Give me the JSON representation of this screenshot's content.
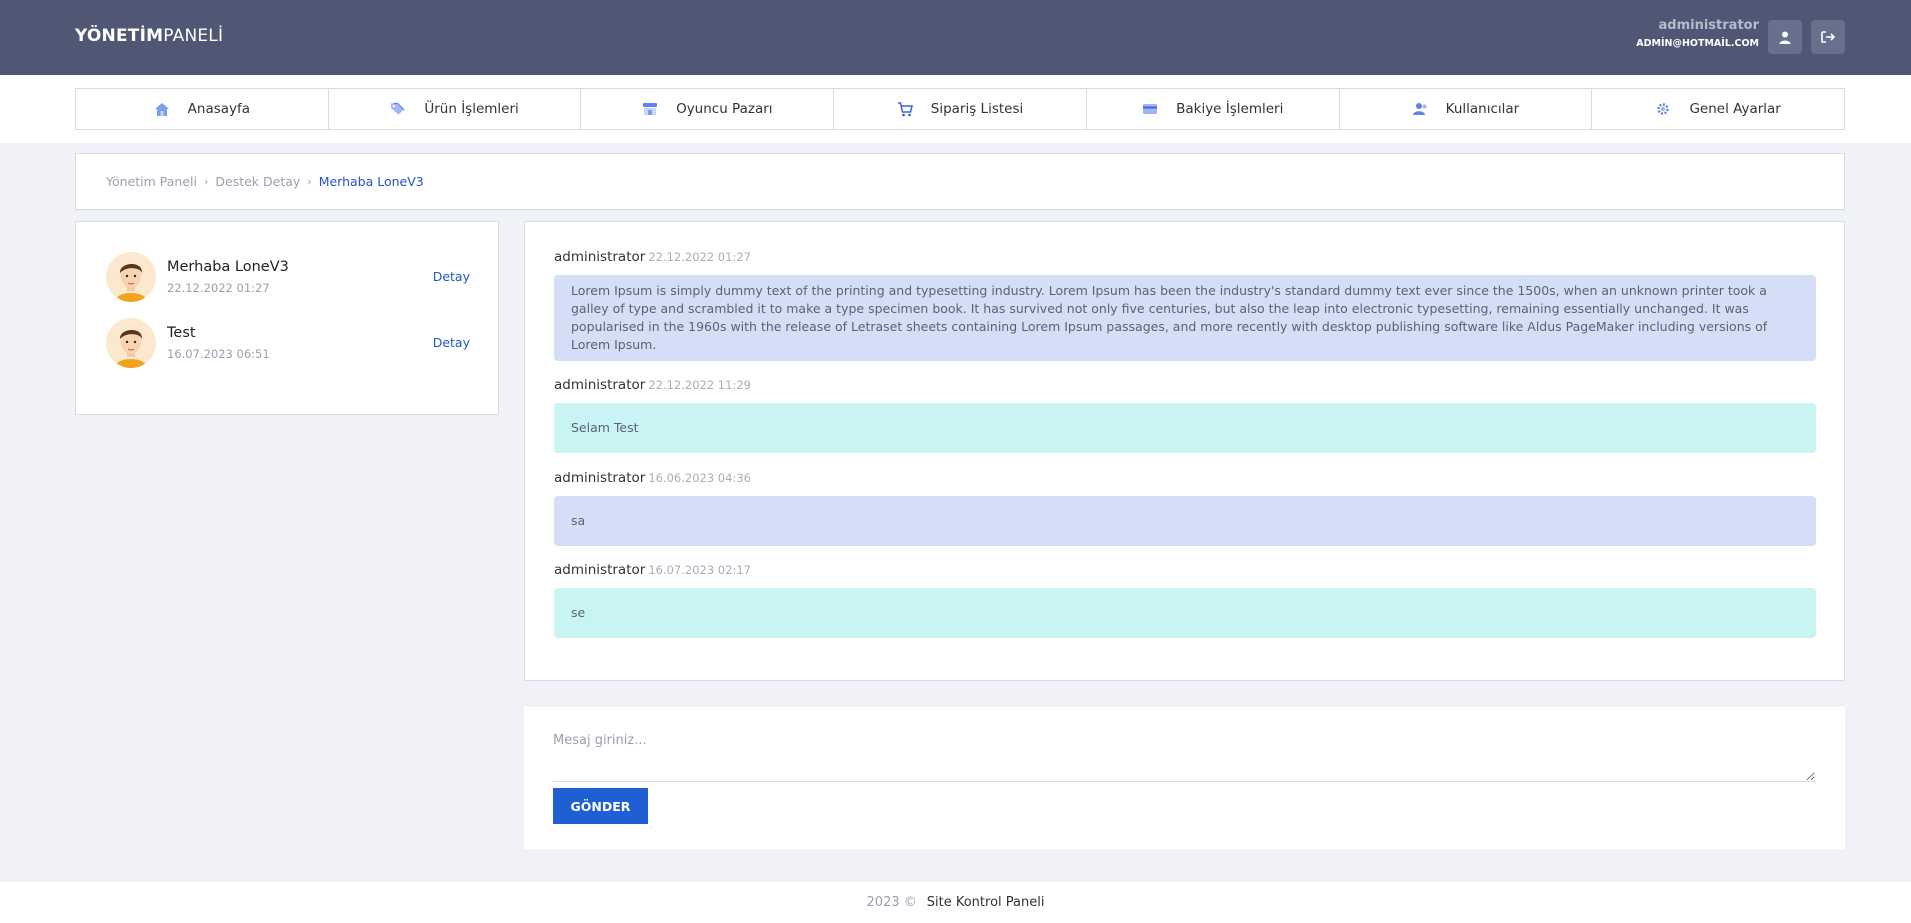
{
  "header": {
    "brand_bold": "YÖNETİM",
    "brand_light": "PANELİ",
    "user_name": "administrator",
    "user_email": "ADMİN@HOTMAİL.COM",
    "profile_icon": "user-icon",
    "logout_icon": "sign-out-icon"
  },
  "nav": {
    "items": [
      {
        "label": "Anasayfa",
        "icon": "home-icon"
      },
      {
        "label": "Ürün İşlemleri",
        "icon": "tags-icon"
      },
      {
        "label": "Oyuncu Pazarı",
        "icon": "store-icon"
      },
      {
        "label": "Sipariş Listesi",
        "icon": "cart-icon"
      },
      {
        "label": "Bakiye İşlemleri",
        "icon": "credit-card-icon"
      },
      {
        "label": "Kullanıcılar",
        "icon": "users-icon"
      },
      {
        "label": "Genel Ayarlar",
        "icon": "gear-icon"
      }
    ]
  },
  "breadcrumb": {
    "items": [
      "Yönetim Paneli",
      "Destek Detay",
      "Merhaba LoneV3"
    ],
    "separator": "›"
  },
  "tickets": [
    {
      "title": "Merhaba LoneV3",
      "date": "22.12.2022 01:27",
      "action": "Detay"
    },
    {
      "title": "Test",
      "date": "16.07.2023 06:51",
      "action": "Detay"
    }
  ],
  "messages": [
    {
      "author": "administrator",
      "date": "22.12.2022 01:27",
      "color": "#d5def7",
      "text": "Lorem Ipsum is simply dummy text of the printing and typesetting industry. Lorem Ipsum has been the industry's standard dummy text ever since the 1500s, when an unknown printer took a galley of type and scrambled it to make a type specimen book. It has survived not only five centuries, but also the leap into electronic typesetting, remaining essentially unchanged. It was popularised in the 1960s with the release of Letraset sheets containing Lorem Ipsum passages, and more recently with desktop publishing software like Aldus PageMaker including versions of Lorem Ipsum."
    },
    {
      "author": "administrator",
      "date": "22.12.2022 11:29",
      "color": "#c8f5f3",
      "text": "Selam Test"
    },
    {
      "author": "administrator",
      "date": "16.06.2023 04:36",
      "color": "#d5def7",
      "text": "sa"
    },
    {
      "author": "administrator",
      "date": "16.07.2023 02:17",
      "color": "#c8f5f3",
      "text": "se"
    }
  ],
  "compose": {
    "placeholder": "Mesaj giriniz...",
    "value": "",
    "send_label": "GÖNDER"
  },
  "footer": {
    "year": "2023 ©",
    "site": "Site Kontrol Paneli"
  },
  "colors": {
    "header_bg": "#4f5775",
    "accent": "#1f5fd4",
    "link": "#2354c8",
    "bubble_blue": "#d5def7",
    "bubble_cyan": "#c8f5f3"
  }
}
